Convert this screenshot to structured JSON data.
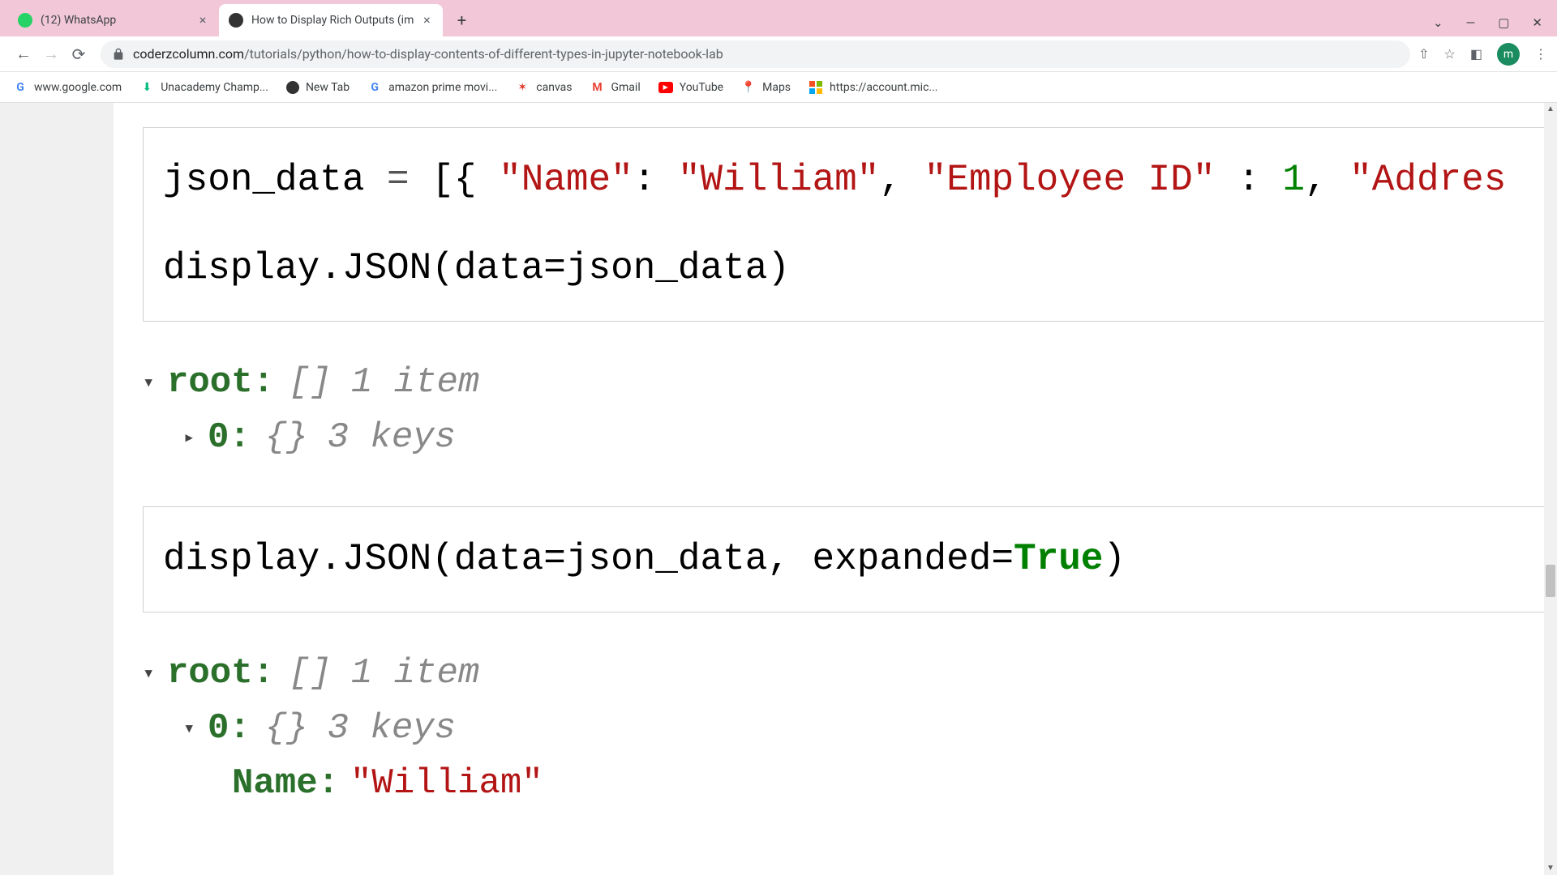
{
  "tabs": [
    {
      "title": "(12) WhatsApp",
      "favicon_color": "#25d366"
    },
    {
      "title": "How to Display Rich Outputs (im",
      "favicon_color": "#333333"
    }
  ],
  "url": {
    "domain": "coderzcolumn.com",
    "path": "/tutorials/python/how-to-display-contents-of-different-types-in-jupyter-notebook-lab"
  },
  "bookmarks": [
    {
      "label": "www.google.com",
      "icon": "G"
    },
    {
      "label": "Unacademy Champ...",
      "icon": "u"
    },
    {
      "label": "New Tab",
      "icon": "●"
    },
    {
      "label": "amazon prime movi...",
      "icon": "G"
    },
    {
      "label": "canvas",
      "icon": "c"
    },
    {
      "label": "Gmail",
      "icon": "M"
    },
    {
      "label": "YouTube",
      "icon": "Y"
    },
    {
      "label": "Maps",
      "icon": "m"
    },
    {
      "label": "https://account.mic...",
      "icon": "ms"
    }
  ],
  "avatar_letter": "m",
  "code1": {
    "line1_parts": [
      "json_data ",
      "= ",
      "[{ ",
      "\"Name\"",
      ": ",
      "\"William\"",
      ", ",
      "\"Employee ID\"",
      " : ",
      "1",
      ", ",
      "\"Addres"
    ],
    "line2": "display.JSON(data=json_data)"
  },
  "output1": {
    "root_label": "root:",
    "root_type": "[]",
    "root_meta": "1 item",
    "child_label": "0:",
    "child_type": "{}",
    "child_meta": "3 keys"
  },
  "code2": {
    "prefix": "display.JSON(data=json_data, expanded=",
    "kw": "True",
    "suffix": ")"
  },
  "output2": {
    "root_label": "root:",
    "root_type": "[]",
    "root_meta": "1 item",
    "child_label": "0:",
    "child_type": "{}",
    "child_meta": "3 keys",
    "k1": "Name:",
    "v1": "\"William\""
  }
}
